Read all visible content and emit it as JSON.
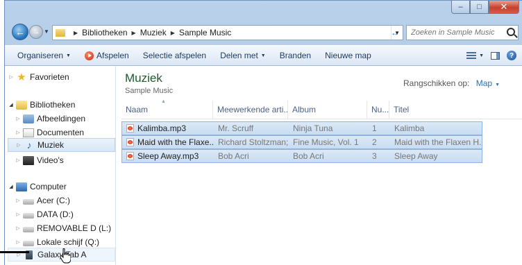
{
  "address": {
    "breadcrumbs": [
      "Bibliotheken",
      "Muziek",
      "Sample Music"
    ]
  },
  "search": {
    "placeholder": "Zoeken in Sample Music"
  },
  "toolbar": {
    "organize": "Organiseren",
    "play": "Afspelen",
    "play_selection": "Selectie afspelen",
    "share": "Delen met",
    "burn": "Branden",
    "new_folder": "Nieuwe map"
  },
  "nav": {
    "favorites": "Favorieten",
    "libraries": "Bibliotheken",
    "pictures": "Afbeeldingen",
    "documents": "Documenten",
    "music": "Muziek",
    "videos": "Video's",
    "computer": "Computer",
    "drive_c": "Acer (C:)",
    "drive_d": "DATA (D:)",
    "drive_l": "REMOVABLE D (L:)",
    "drive_q": "Lokale schijf (Q:)",
    "device": "Galaxy Tab A"
  },
  "content": {
    "title": "Muziek",
    "subtitle": "Sample Music",
    "arrange_label": "Rangschikken op:",
    "arrange_value": "Map"
  },
  "columns": {
    "name": "Naam",
    "artists": "Meewerkende arti...",
    "album": "Album",
    "number": "Nu...",
    "title": "Titel"
  },
  "files": [
    {
      "name": "Kalimba.mp3",
      "artist": "Mr. Scruff",
      "album": "Ninja Tuna",
      "number": "1",
      "title": "Kalimba"
    },
    {
      "name": "Maid with the Flaxe...",
      "artist": "Richard Stoltzman;...",
      "album": "Fine Music, Vol. 1",
      "number": "2",
      "title": "Maid with the Flaxen H..."
    },
    {
      "name": "Sleep Away.mp3",
      "artist": "Bob Acri",
      "album": "Bob Acri",
      "number": "3",
      "title": "Sleep Away"
    }
  ]
}
